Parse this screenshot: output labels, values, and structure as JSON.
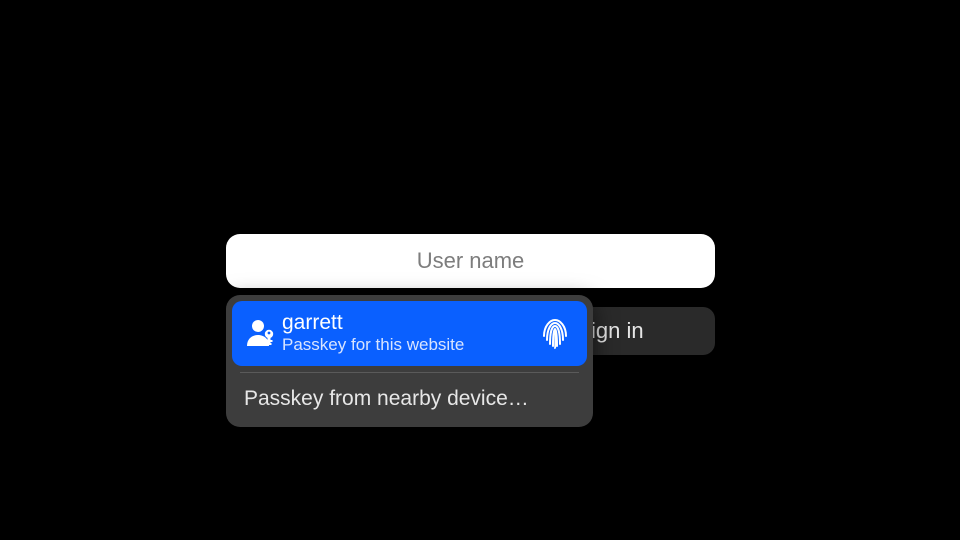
{
  "input": {
    "placeholder": "User name",
    "value": ""
  },
  "signin": {
    "label": "Sign in"
  },
  "popup": {
    "selected": {
      "username": "garrett",
      "subtitle": "Passkey for this website"
    },
    "nearby": {
      "label": "Passkey from nearby device…"
    }
  },
  "icons": {
    "user_passkey": "user-passkey-icon",
    "fingerprint": "fingerprint-icon"
  },
  "colors": {
    "highlight": "#0a60ff",
    "popup_bg": "#3d3d3d"
  }
}
